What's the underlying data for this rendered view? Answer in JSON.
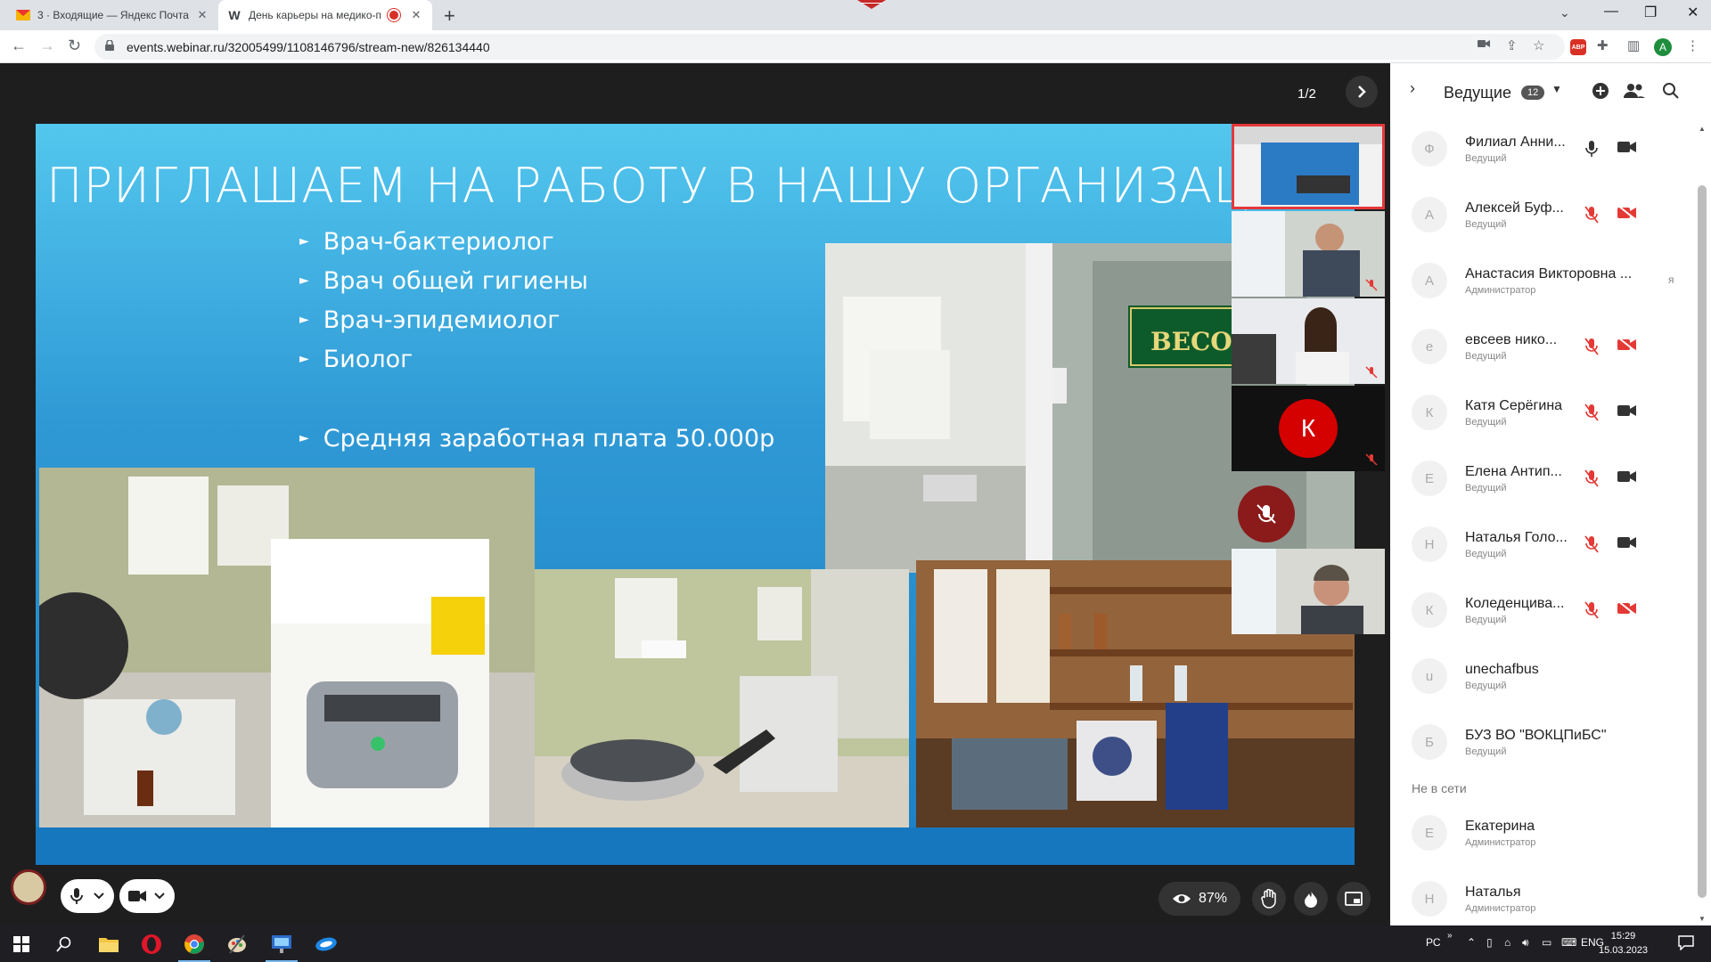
{
  "browser": {
    "tabs": [
      {
        "title": "3 · Входящие — Яндекс Почта",
        "favicon": "envelope-icon",
        "active": false
      },
      {
        "title": "День карьеры на медико-п",
        "favicon": "W",
        "active": true,
        "recording": true
      }
    ],
    "url": "events.webinar.ru/32005499/1108146796/stream-new/826134440",
    "profile_initial": "A",
    "abp_label": "ABP"
  },
  "stream": {
    "page_indicator": "1/2",
    "slide": {
      "title": "ПРИГЛАШАЕМ НА РАБОТУ В НАШУ ОРГАНИЗАЦИЮ",
      "bullets": [
        "Врач-бактериолог",
        "Врач общей гигиены",
        "Врач-эпидемиолог",
        "Биолог"
      ],
      "salary": "Средняя заработная плата 50.000р",
      "sign_text": "ВЕСОВАЯ"
    },
    "tile_avatar_initial": "К",
    "view_percent": "87%"
  },
  "panel": {
    "title": "Ведущие",
    "count": "12",
    "online": [
      {
        "initial": "Ф",
        "name": "Филиал Анни...",
        "role": "Ведущий",
        "mic_on": true,
        "cam_on": true
      },
      {
        "initial": "А",
        "name": "Алексей Буф...",
        "role": "Ведущий",
        "mic_on": false,
        "cam_on": false
      },
      {
        "initial": "А",
        "name": "Анастасия Викторовна ...",
        "role": "Администратор",
        "extra": "я"
      },
      {
        "initial": "е",
        "name": "евсеев нико...",
        "role": "Ведущий",
        "mic_on": false,
        "cam_on": false
      },
      {
        "initial": "К",
        "name": "Катя Серёгина",
        "role": "Ведущий",
        "mic_on": false,
        "cam_on": true
      },
      {
        "initial": "Е",
        "name": "Елена Антип...",
        "role": "Ведущий",
        "mic_on": false,
        "cam_on": true
      },
      {
        "initial": "Н",
        "name": "Наталья Голо...",
        "role": "Ведущий",
        "mic_on": false,
        "cam_on": true
      },
      {
        "initial": "К",
        "name": "Коледенцива...",
        "role": "Ведущий",
        "mic_on": false,
        "cam_on": false
      },
      {
        "initial": "u",
        "name": "unechafbus",
        "role": "Ведущий"
      },
      {
        "initial": "Б",
        "name": "БУЗ ВО \"ВОКЦПиБС\"",
        "role": "Ведущий"
      }
    ],
    "offline_label": "Не в сети",
    "offline": [
      {
        "initial": "Е",
        "name": "Екатерина",
        "role": "Администратор"
      },
      {
        "initial": "Н",
        "name": "Наталья",
        "role": "Администратор"
      }
    ]
  },
  "taskbar": {
    "lang_short": "РС",
    "lang": "ENG",
    "time": "15:29",
    "date": "15.03.2023"
  },
  "colors": {
    "accent_red": "#d93025",
    "slide_blue": "#2f99d5",
    "panel_bg": "#ffffff"
  }
}
